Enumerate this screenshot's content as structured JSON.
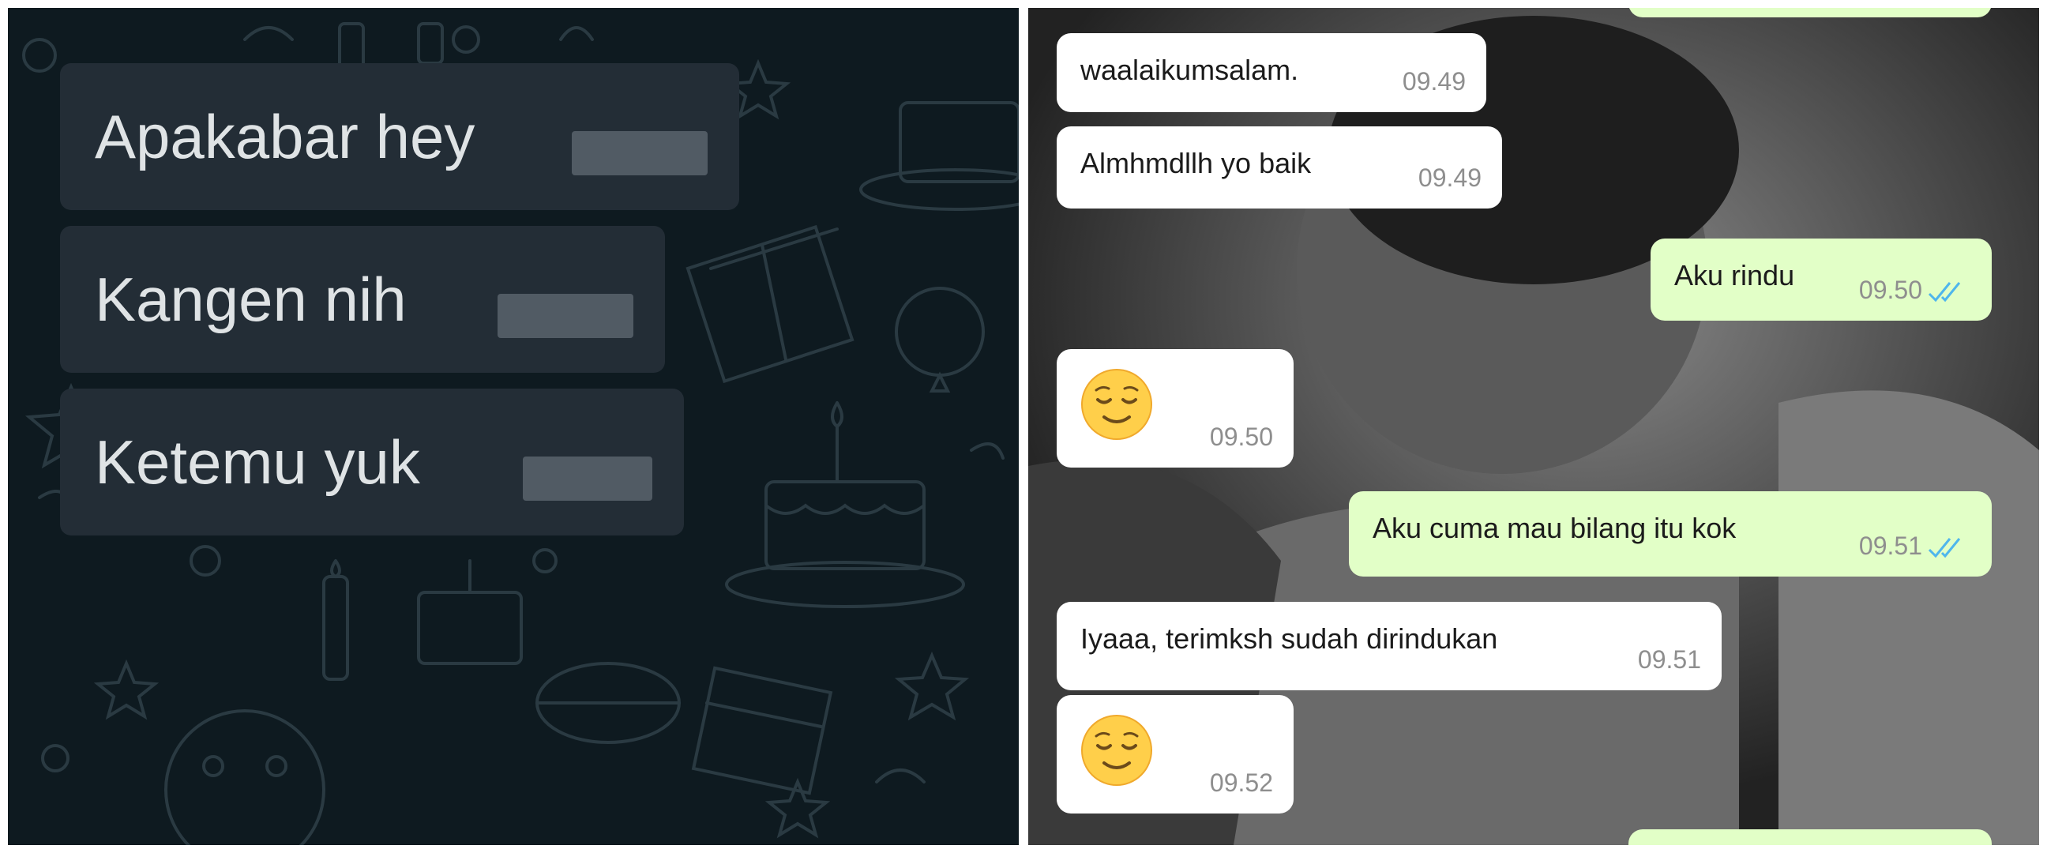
{
  "left_chat": {
    "messages": [
      {
        "text": "Apakabar hey"
      },
      {
        "text": "Kangen nih"
      },
      {
        "text": "Ketemu yuk"
      }
    ]
  },
  "right_chat": {
    "messages": [
      {
        "direction": "incoming",
        "text": "waalaikumsalam.",
        "time": "09.49"
      },
      {
        "direction": "incoming",
        "text": "Almhmdllh yo baik",
        "time": "09.49"
      },
      {
        "direction": "outgoing",
        "text": "Aku rindu",
        "time": "09.50",
        "status": "read"
      },
      {
        "direction": "incoming",
        "emoji": "relieved-face-emoji",
        "time": "09.50"
      },
      {
        "direction": "outgoing",
        "text": "Aku cuma mau bilang itu kok",
        "time": "09.51",
        "status": "read"
      },
      {
        "direction": "incoming",
        "text": "Iyaaa, terimksh sudah dirindukan",
        "time": "09.51"
      },
      {
        "direction": "incoming",
        "emoji": "relieved-face-emoji",
        "time": "09.52"
      }
    ]
  },
  "colors": {
    "dark_wallpaper": "#0e1a20",
    "dark_bubble": "#232d36",
    "incoming_bubble": "#ffffff",
    "outgoing_bubble": "#e2ffc7",
    "read_tick": "#4fb6ec"
  }
}
